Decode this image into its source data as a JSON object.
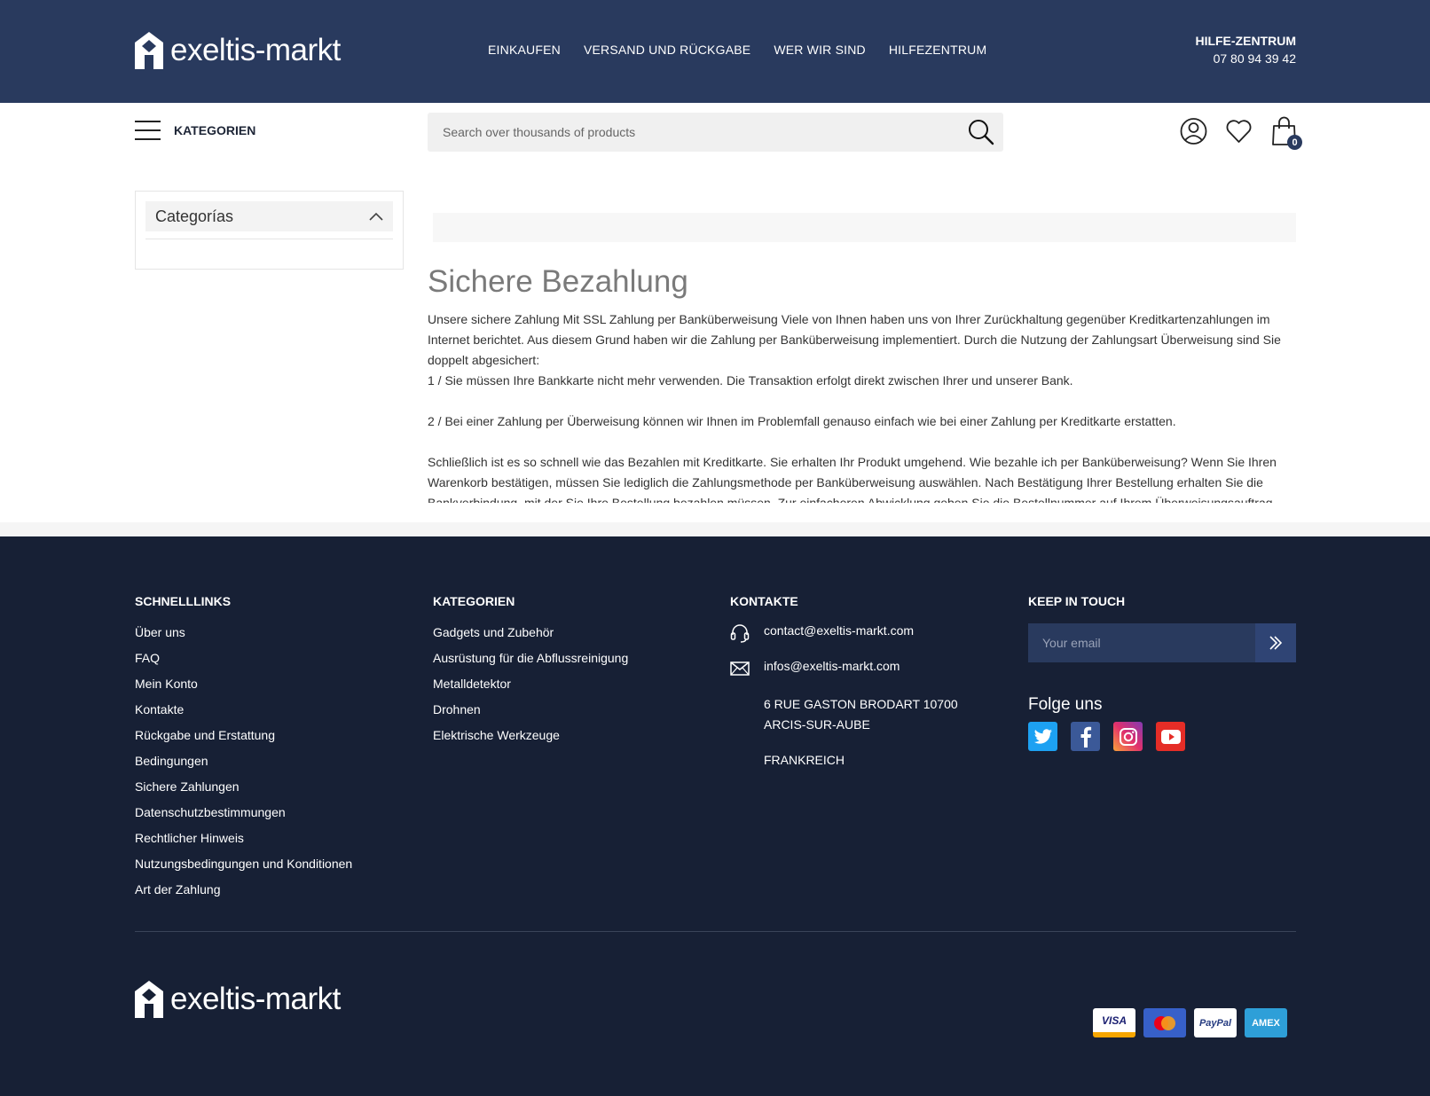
{
  "brand": {
    "name": "exeltis-markt"
  },
  "top_nav": [
    "EINKAUFEN",
    "VERSAND UND RÜCKGABE",
    "WER WIR SIND",
    "HILFEZENTRUM"
  ],
  "help": {
    "title": "HILFE-ZENTRUM",
    "phone": "07 80 94 39 42"
  },
  "menu": {
    "label": "KATEGORIEN"
  },
  "search": {
    "placeholder": "Search over thousands of products"
  },
  "cart": {
    "count": "0"
  },
  "sidebar": {
    "title": "Categorías"
  },
  "page": {
    "title": "Sichere Bezahlung",
    "paragraphs": [
      "Unsere sichere Zahlung Mit SSL Zahlung per Banküberweisung Viele von Ihnen haben uns von Ihrer Zurückhaltung gegenüber Kreditkartenzahlungen im Internet berichtet. Aus diesem Grund haben wir die Zahlung per Banküberweisung implementiert. Durch die Nutzung der Zahlungsart Überweisung sind Sie doppelt abgesichert:",
      "1 / Sie müssen Ihre Bankkarte nicht mehr verwenden. Die Transaktion erfolgt direkt zwischen Ihrer und unserer Bank.",
      "2 / Bei einer Zahlung per Überweisung können wir Ihnen im Problemfall genauso einfach wie bei einer Zahlung per Kreditkarte erstatten.",
      "Schließlich ist es so schnell wie das Bezahlen mit Kreditkarte. Sie erhalten Ihr Produkt umgehend. Wie bezahle ich per Banküberweisung? Wenn Sie Ihren Warenkorb bestätigen, müssen Sie lediglich die Zahlungsmethode per Banküberweisung auswählen. Nach Bestätigung Ihrer Bestellung erhalten Sie die Bankverbindung, mit der Sie Ihre Bestellung bezahlen müssen. Zur einfacheren Abwicklung geben Sie die Bestellnummer auf Ihrem Überweisungsauftrag"
    ]
  },
  "footer": {
    "quicklinks": {
      "title": "SCHNELLLINKS",
      "items": [
        "Über uns",
        "FAQ",
        "Mein Konto",
        "Kontakte",
        "Rückgabe und Erstattung",
        "Bedingungen",
        "Sichere Zahlungen",
        "Datenschutzbestimmungen",
        "Rechtlicher Hinweis",
        "Nutzungsbedingungen und Konditionen",
        "Art der Zahlung"
      ]
    },
    "categories": {
      "title": "KATEGORIEN",
      "items": [
        "Gadgets und Zubehör",
        "Ausrüstung für die Abflussreinigung",
        "Metalldetektor",
        "Drohnen",
        "Elektrische Werkzeuge"
      ]
    },
    "contacts": {
      "title": "KONTAKTE",
      "email1": "contact@exeltis-markt.com",
      "email2": "infos@exeltis-markt.com",
      "address": "6 RUE GASTON BRODART 10700 ARCIS-SUR-AUBE",
      "country": "FRANKREICH"
    },
    "newsletter": {
      "title": "KEEP IN TOUCH",
      "placeholder": "Your email",
      "follow": "Folge uns",
      "social": [
        "twitter-icon",
        "facebook-icon",
        "instagram-icon",
        "youtube-icon"
      ]
    },
    "payments": [
      "VISA",
      "Mastercard",
      "PayPal",
      "AMEX"
    ]
  },
  "colors": {
    "header": "#293a5e",
    "footer": "#172035",
    "accent": "#2f4474"
  }
}
